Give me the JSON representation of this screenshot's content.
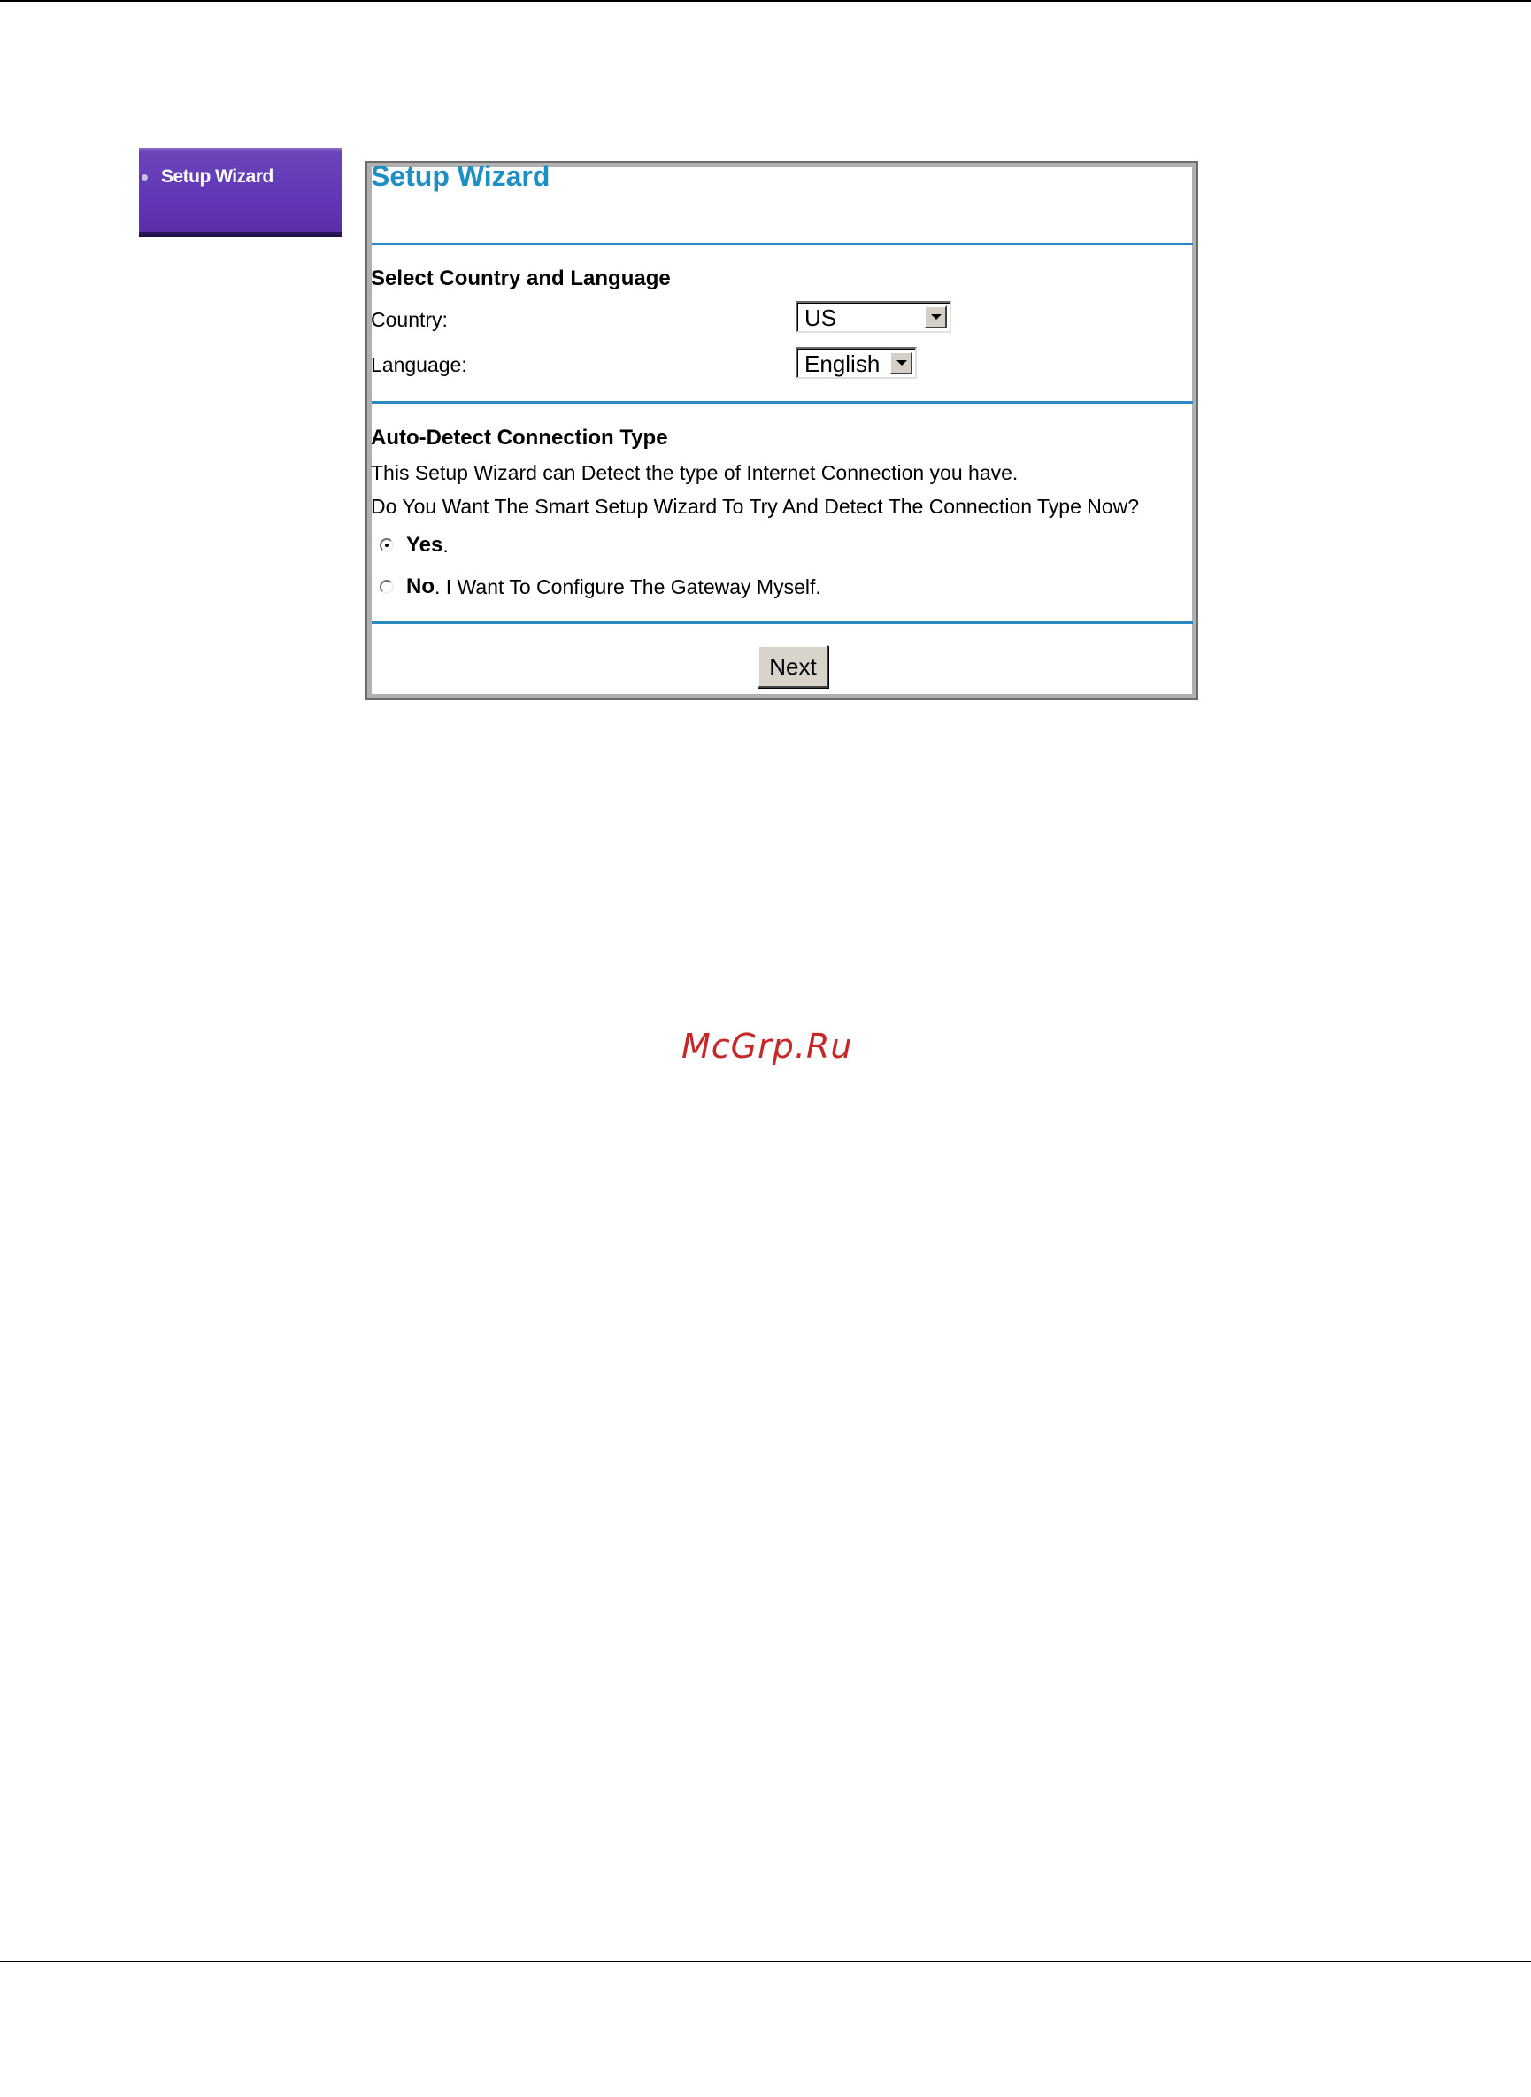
{
  "sidebar": {
    "items": [
      {
        "label": "Setup Wizard"
      }
    ]
  },
  "panel": {
    "title": "Setup Wizard",
    "country_language": {
      "heading": "Select Country and Language",
      "country_label": "Country:",
      "country_value": "US",
      "language_label": "Language:",
      "language_value": "English"
    },
    "auto_detect": {
      "heading": "Auto-Detect Connection Type",
      "line1": "This Setup Wizard can Detect the type of Internet Connection you have.",
      "line2": "Do You Want The Smart Setup Wizard To Try And Detect The Connection Type Now?",
      "yes_strong": "Yes",
      "yes_rest": ".",
      "yes_checked": true,
      "no_strong": "No",
      "no_rest": ". I Want To Configure The Gateway Myself.",
      "no_checked": false
    },
    "next_label": "Next"
  },
  "watermark": "McGrp.Ru",
  "colors": {
    "title": "#1e8fc4",
    "divider": "#2a8ac0",
    "sidebar": "#6236b8",
    "watermark": "#c62828"
  }
}
